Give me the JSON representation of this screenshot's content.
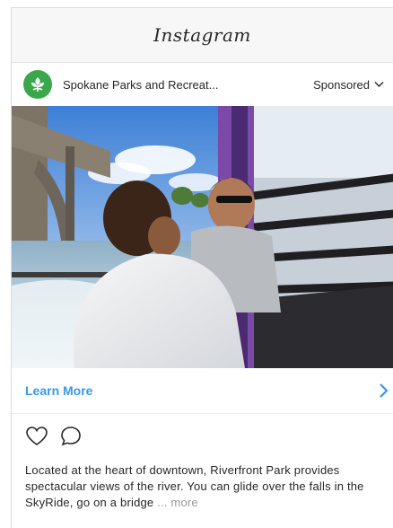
{
  "app": {
    "title": "Instagram"
  },
  "post": {
    "account_name": "Spokane Parks and Recreat...",
    "sponsored_label": "Sponsored",
    "image_alt_icon": "photo-riders-in-skyride-gondola",
    "cta_label": "Learn More",
    "caption_text": "Located at the heart of downtown, Riverfront Park provides spectacular views of the river. You can glide over the falls in the SkyRide, go on a bridge",
    "caption_ellipsis": "...",
    "more_label": "more"
  },
  "colors": {
    "link_blue": "#3897f0",
    "avatar_green": "#3aa84a",
    "text": "#262626",
    "muted": "#999999"
  },
  "icons": {
    "avatar": "leaf-logo-icon",
    "sponsored_menu": "chevron-down-icon",
    "cta": "chevron-right-icon",
    "like": "heart-icon",
    "comment": "comment-icon"
  }
}
